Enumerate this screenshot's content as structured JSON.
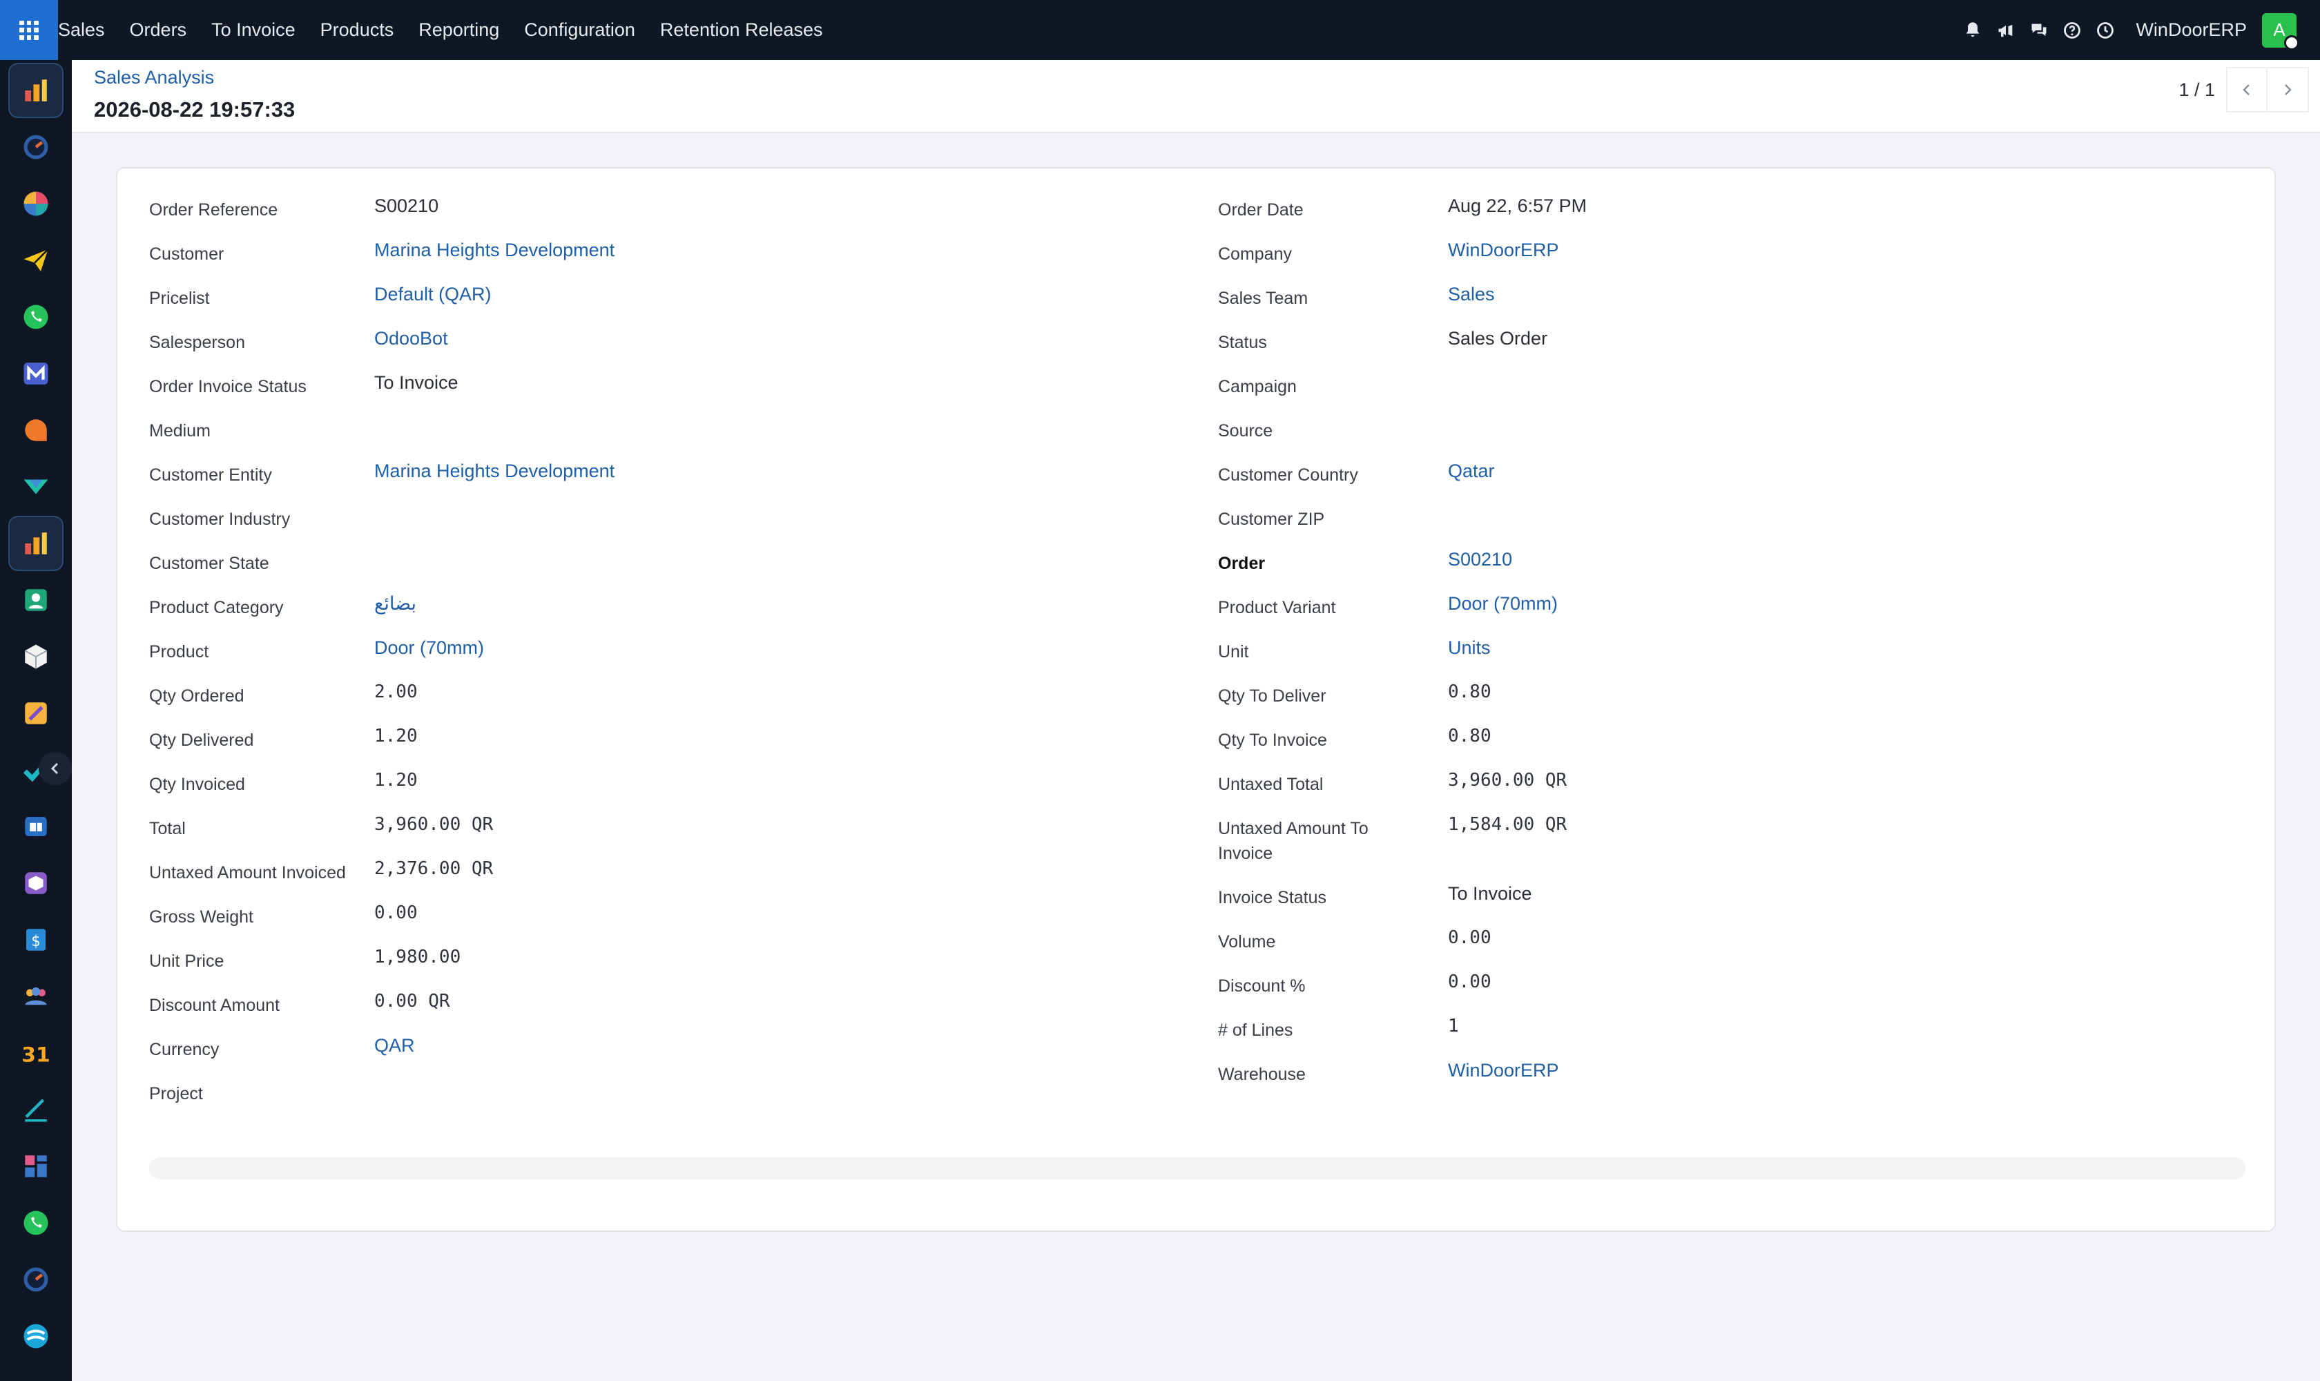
{
  "nav": {
    "menu": [
      "Sales",
      "Orders",
      "To Invoice",
      "Products",
      "Reporting",
      "Configuration",
      "Retention Releases"
    ],
    "company": "WinDoorERP",
    "avatar_letter": "A",
    "icons": [
      "bell-icon",
      "megaphone-icon",
      "chat-icon",
      "help-icon",
      "clock-icon"
    ]
  },
  "sidebar": {
    "apps": [
      "sales-chart-app",
      "dashboard-dial-app",
      "pie-app",
      "telegram-app",
      "whatsapp-app",
      "marketing-app",
      "chat-bubble-app",
      "marketing-arrow-app",
      "sales-analysis-app",
      "contacts-app",
      "inventory-app",
      "documents-app",
      "tasks-app",
      "knowledge-app",
      "package-app",
      "invoicing-app",
      "employees-app",
      "calendar-app",
      "sign-app",
      "dashboard-grid-app",
      "whatsapp-app-2",
      "dial-app-2",
      "discuss-app"
    ],
    "calendar_day": "31"
  },
  "control_panel": {
    "breadcrumb": "Sales Analysis",
    "title": "2026-08-22 19:57:33",
    "pager": "1 / 1"
  },
  "form": {
    "left": [
      {
        "label": "Order Reference",
        "value": "S00210",
        "type": "text"
      },
      {
        "label": "Customer",
        "value": "Marina Heights Development",
        "type": "link"
      },
      {
        "label": "Pricelist",
        "value": "Default (QAR)",
        "type": "link"
      },
      {
        "label": "Salesperson",
        "value": "OdooBot",
        "type": "link"
      },
      {
        "label": "Order Invoice Status",
        "value": "To Invoice",
        "type": "text"
      },
      {
        "label": "Medium",
        "value": "",
        "type": "text"
      },
      {
        "label": "Customer Entity",
        "value": "Marina Heights Development",
        "type": "link"
      },
      {
        "label": "Customer Industry",
        "value": "",
        "type": "text"
      },
      {
        "label": "Customer State",
        "value": "",
        "type": "text"
      },
      {
        "label": "Product Category",
        "value": "بضائع",
        "type": "link"
      },
      {
        "label": "Product",
        "value": "Door (70mm)",
        "type": "link"
      },
      {
        "label": "Qty Ordered",
        "value": "2.00",
        "type": "mono"
      },
      {
        "label": "Qty Delivered",
        "value": "1.20",
        "type": "mono"
      },
      {
        "label": "Qty Invoiced",
        "value": "1.20",
        "type": "mono"
      },
      {
        "label": "Total",
        "value": "3,960.00 QR",
        "type": "mono"
      },
      {
        "label": "Untaxed Amount Invoiced",
        "value": "2,376.00 QR",
        "type": "mono"
      },
      {
        "label": "Gross Weight",
        "value": "0.00",
        "type": "mono"
      },
      {
        "label": "Unit Price",
        "value": "1,980.00",
        "type": "mono"
      },
      {
        "label": "Discount Amount",
        "value": "0.00 QR",
        "type": "mono"
      },
      {
        "label": "Currency",
        "value": "QAR",
        "type": "link"
      },
      {
        "label": "Project",
        "value": "",
        "type": "text"
      }
    ],
    "right": [
      {
        "label": "Order Date",
        "value": "Aug 22, 6:57 PM",
        "type": "text"
      },
      {
        "label": "Company",
        "value": "WinDoorERP",
        "type": "link"
      },
      {
        "label": "Sales Team",
        "value": "Sales",
        "type": "link"
      },
      {
        "label": "Status",
        "value": "Sales Order",
        "type": "text"
      },
      {
        "label": "Campaign",
        "value": "",
        "type": "text"
      },
      {
        "label": "Source",
        "value": "",
        "type": "text"
      },
      {
        "label": "Customer Country",
        "value": "Qatar",
        "type": "link"
      },
      {
        "label": "Customer ZIP",
        "value": "",
        "type": "text"
      },
      {
        "label": "Order",
        "value": "S00210",
        "type": "link",
        "strong": true
      },
      {
        "label": "Product Variant",
        "value": "Door (70mm)",
        "type": "link"
      },
      {
        "label": "Unit",
        "value": "Units",
        "type": "link"
      },
      {
        "label": "Qty To Deliver",
        "value": "0.80",
        "type": "mono"
      },
      {
        "label": "Qty To Invoice",
        "value": "0.80",
        "type": "mono"
      },
      {
        "label": "Untaxed Total",
        "value": "3,960.00 QR",
        "type": "mono"
      },
      {
        "label": "Untaxed Amount To Invoice",
        "value": "1,584.00 QR",
        "type": "mono",
        "tall": true
      },
      {
        "label": "Invoice Status",
        "value": "To Invoice",
        "type": "text"
      },
      {
        "label": "Volume",
        "value": "0.00",
        "type": "mono"
      },
      {
        "label": "Discount %",
        "value": "0.00",
        "type": "mono"
      },
      {
        "label": "# of Lines",
        "value": "1",
        "type": "mono"
      },
      {
        "label": "Warehouse",
        "value": "WinDoorERP",
        "type": "link"
      }
    ]
  }
}
